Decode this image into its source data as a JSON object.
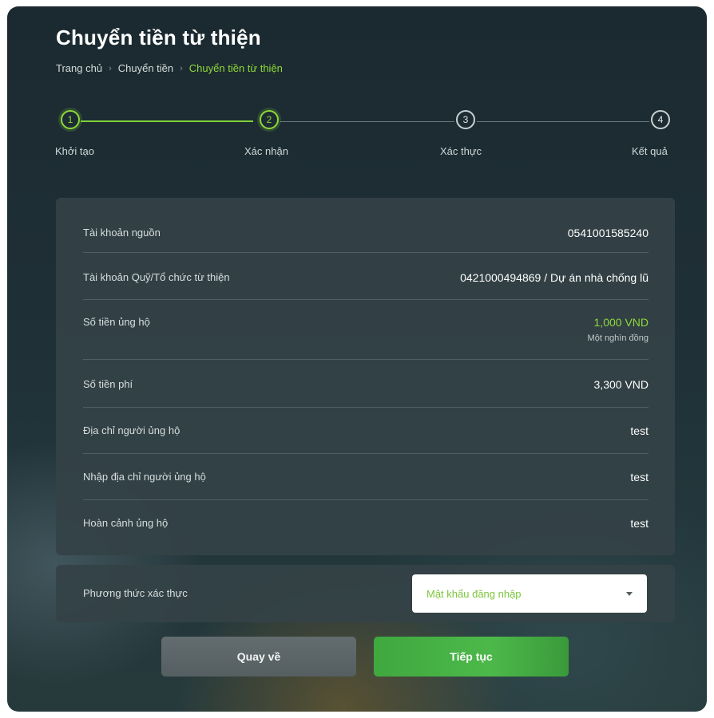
{
  "page": {
    "title": "Chuyển tiền từ thiện"
  },
  "breadcrumb": {
    "items": [
      "Trang chủ",
      "Chuyển tiền",
      "Chuyển tiền từ thiện"
    ],
    "separator": "›"
  },
  "stepper": {
    "steps": [
      {
        "number": "1",
        "label": "Khởi tạo"
      },
      {
        "number": "2",
        "label": "Xác nhận"
      },
      {
        "number": "3",
        "label": "Xác thực"
      },
      {
        "number": "4",
        "label": "Kết quả"
      }
    ],
    "current_step": 2
  },
  "details": {
    "rows": [
      {
        "label": "Tài khoản nguồn",
        "value": "0541001585240"
      },
      {
        "label": "Tài khoản Quỹ/Tổ chức từ thiện",
        "value": "0421000494869 / Dự án nhà chống lũ"
      },
      {
        "label": "Số tiền ủng hộ",
        "value": "1,000 VND",
        "subtext": "Một nghìn đồng"
      },
      {
        "label": "Số tiền phí",
        "value": "3,300 VND"
      },
      {
        "label": "Địa chỉ người ủng hộ",
        "value": "test"
      },
      {
        "label": "Nhập địa chỉ người ủng hộ",
        "value": "test"
      },
      {
        "label": "Hoàn cảnh ủng hộ",
        "value": "test"
      }
    ]
  },
  "auth": {
    "label": "Phương thức xác thực",
    "selected": "Mật khẩu đăng nhập"
  },
  "buttons": {
    "back": "Quay về",
    "next": "Tiếp tục"
  },
  "colors": {
    "accent": "#8fd93a",
    "primary_button": "#46b146",
    "secondary_button": "#5c6668",
    "card_background": "#344246"
  }
}
